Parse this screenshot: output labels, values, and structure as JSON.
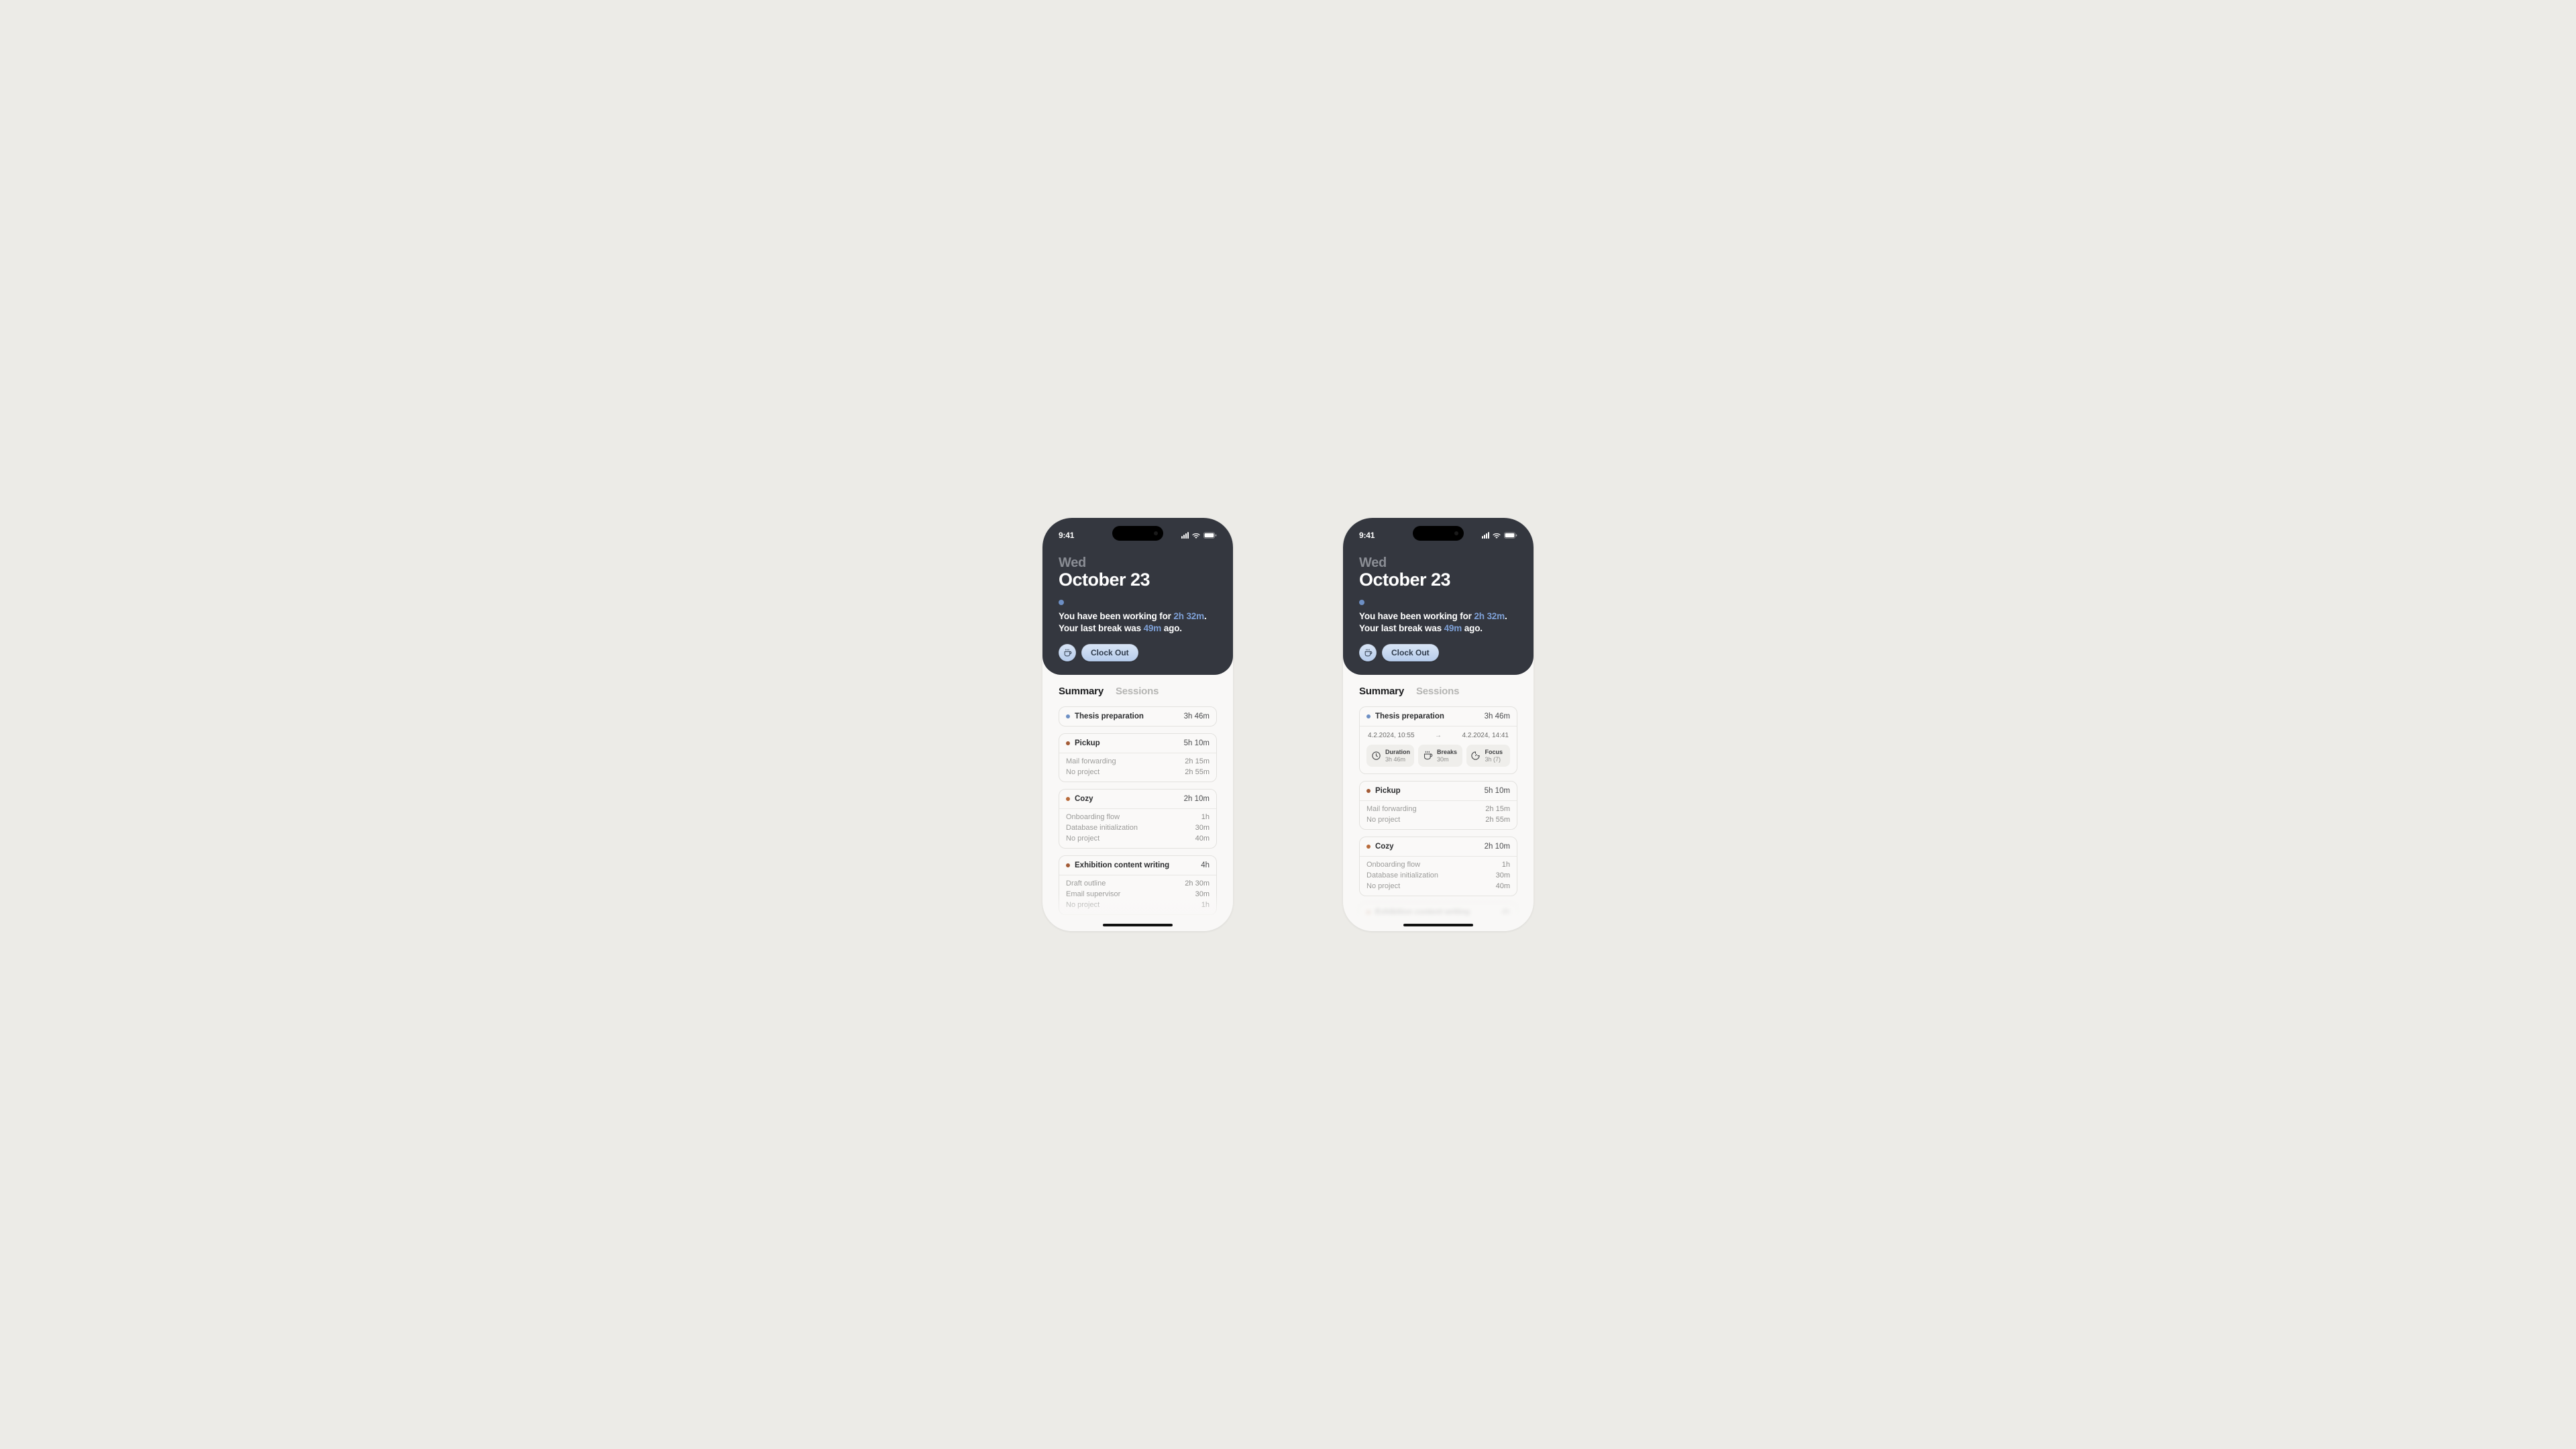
{
  "status_bar": {
    "time": "9:41"
  },
  "header": {
    "day": "Wed",
    "date": "October 23",
    "line1_prefix": "You have been working for ",
    "working_duration": "2h 32m",
    "line1_suffix": ".",
    "line2_prefix": "Your last break was ",
    "break_ago": "49m",
    "line2_suffix": " ago.",
    "clock_out_label": "Clock Out"
  },
  "tabs": {
    "summary": "Summary",
    "sessions": "Sessions"
  },
  "colors": {
    "blue": "#6d8fc4",
    "brown": "#a35b36",
    "orange": "#b86a3a"
  },
  "phone1": {
    "cards": [
      {
        "dot": "blue",
        "title": "Thesis preparation",
        "duration": "3h 46m",
        "items": []
      },
      {
        "dot": "brown",
        "title": "Pickup",
        "duration": "5h 10m",
        "items": [
          {
            "label": "Mail forwarding",
            "value": "2h 15m"
          },
          {
            "label": "No project",
            "value": "2h 55m"
          }
        ]
      },
      {
        "dot": "orange",
        "title": "Cozy",
        "duration": "2h 10m",
        "items": [
          {
            "label": "Onboarding flow",
            "value": "1h"
          },
          {
            "label": "Database initialization",
            "value": "30m"
          },
          {
            "label": "No project",
            "value": "40m"
          }
        ]
      },
      {
        "dot": "brown",
        "title": "Exhibition content writing",
        "duration": "4h",
        "items": [
          {
            "label": "Draft outline",
            "value": "2h 30m"
          },
          {
            "label": "Email supervisor",
            "value": "30m"
          },
          {
            "label": "No project",
            "value": "1h"
          }
        ]
      }
    ]
  },
  "phone2": {
    "expanded": {
      "dot": "blue",
      "title": "Thesis preparation",
      "duration": "3h 46m",
      "range_start": "4.2.2024, 10:55",
      "range_end": "4.2.2024, 14:41",
      "stats": [
        {
          "icon": "clock",
          "label": "Duration",
          "value": "3h 46m"
        },
        {
          "icon": "coffee",
          "label": "Breaks",
          "value": "30m"
        },
        {
          "icon": "focus",
          "label": "Focus",
          "value": "3h (7)"
        }
      ]
    },
    "cards": [
      {
        "dot": "brown",
        "title": "Pickup",
        "duration": "5h 10m",
        "items": [
          {
            "label": "Mail forwarding",
            "value": "2h 15m"
          },
          {
            "label": "No project",
            "value": "2h 55m"
          }
        ]
      },
      {
        "dot": "orange",
        "title": "Cozy",
        "duration": "2h 10m",
        "items": [
          {
            "label": "Onboarding flow",
            "value": "1h"
          },
          {
            "label": "Database initialization",
            "value": "30m"
          },
          {
            "label": "No project",
            "value": "40m"
          }
        ]
      }
    ],
    "faded_title": "Exhibition content writing",
    "faded_duration": "4h"
  }
}
